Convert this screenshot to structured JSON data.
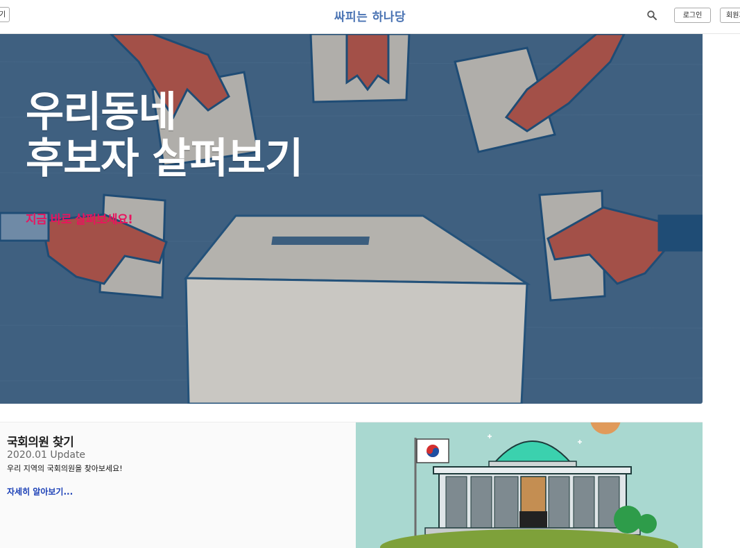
{
  "header": {
    "left_button": "기",
    "title": "싸피는 하나당",
    "login": "로그인",
    "signup": "회원가"
  },
  "hero": {
    "line1": "우리동네",
    "line2": "후보자 살펴보기",
    "subtitle": "지금 바로 살펴보세요!"
  },
  "section": {
    "title": "국회의원 찾기",
    "update": "2020.01 Update",
    "description": "우리 지역의 국회의원을 찾아보세요!",
    "link": "자세히 알아보기..."
  },
  "colors": {
    "brand": "#4a73b3",
    "hero_bg": "#3f6080",
    "accent_pink": "#e8145e",
    "link": "#1a3fb6"
  }
}
